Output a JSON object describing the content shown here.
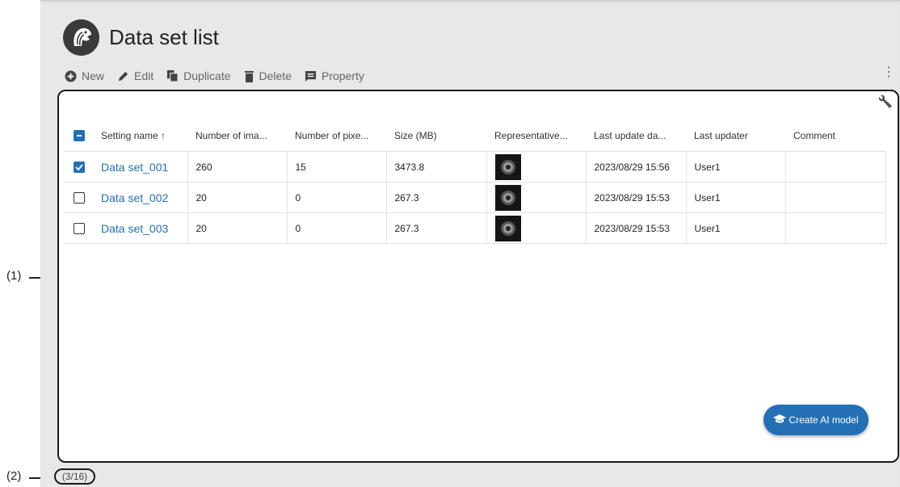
{
  "annotations": {
    "callout_1": "(1)",
    "callout_2": "(2)"
  },
  "header": {
    "title": "Data set list",
    "logo_icon": "eagle-logo-icon"
  },
  "toolbar": {
    "new_label": "New",
    "edit_label": "Edit",
    "duplicate_label": "Duplicate",
    "delete_label": "Delete",
    "property_label": "Property",
    "more_icon": "⋮"
  },
  "table": {
    "columns": {
      "name": "Setting name ↑",
      "images": "Number of ima...",
      "pixels": "Number of pixe...",
      "size": "Size (MB)",
      "representative": "Representative...",
      "updated": "Last update da...",
      "updater": "Last updater",
      "comment": "Comment"
    },
    "rows": [
      {
        "checked": true,
        "name": "Data set_001",
        "images": "260",
        "pixels": "15",
        "size": "3473.8",
        "updated": "2023/08/29 15:56",
        "updater": "User1",
        "comment": ""
      },
      {
        "checked": false,
        "name": "Data set_002",
        "images": "20",
        "pixels": "0",
        "size": "267.3",
        "updated": "2023/08/29 15:53",
        "updater": "User1",
        "comment": ""
      },
      {
        "checked": false,
        "name": "Data set_003",
        "images": "20",
        "pixels": "0",
        "size": "267.3",
        "updated": "2023/08/29 15:53",
        "updater": "User1",
        "comment": ""
      }
    ]
  },
  "fab": {
    "label": "Create AI model"
  },
  "footer": {
    "count": "(3/16)"
  },
  "colors": {
    "accent": "#2470b5",
    "background": "#e8e8e8"
  }
}
